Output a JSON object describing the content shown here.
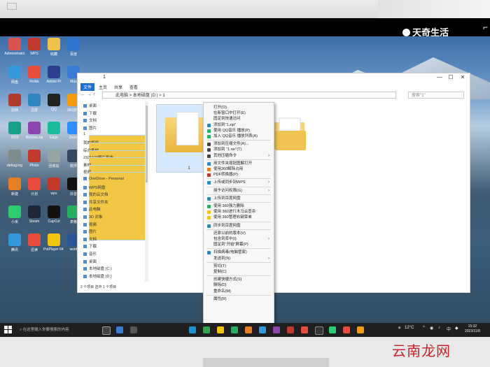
{
  "watermark": {
    "brand": "天奇生活",
    "corner_label": "云南龙网"
  },
  "desktop": {
    "icons": [
      {
        "label": "Administrator",
        "color": "#d9534f"
      },
      {
        "label": "WPS",
        "color": "#c0392b"
      },
      {
        "label": "收藏",
        "color": "#f0c14b"
      },
      {
        "label": "百度",
        "color": "#2f74d0"
      },
      {
        "label": "网盘",
        "color": "#3498db"
      },
      {
        "label": "Rollsk",
        "color": "#e74c3c"
      },
      {
        "label": "Adobe Pr",
        "color": "#2c3e8f"
      },
      {
        "label": "Max",
        "color": "#3a7bd5"
      },
      {
        "label": "剪映",
        "color": "#b03a2e"
      },
      {
        "label": "迅雷",
        "color": "#2e86c1"
      },
      {
        "label": "QQ",
        "color": "#222"
      },
      {
        "label": "360游戏",
        "color": "#f39c12"
      },
      {
        "label": "2020",
        "color": "#16a085"
      },
      {
        "label": "ReVowi.zip",
        "color": "#8e44ad"
      },
      {
        "label": "Edge",
        "color": "#1abc9c"
      },
      {
        "label": "Zoom",
        "color": "#2d8cff"
      },
      {
        "label": "debug.log",
        "color": "#7f8c8d"
      },
      {
        "label": "Photo",
        "color": "#c0392b"
      },
      {
        "label": "回收站",
        "color": "#95a5a6"
      },
      {
        "label": "软件",
        "color": "#34495e"
      },
      {
        "label": "新建",
        "color": "#e67e22"
      },
      {
        "label": "计划",
        "color": "#e74c3c"
      },
      {
        "label": "wps",
        "color": "#c0392b"
      },
      {
        "label": "抖音",
        "color": "#111"
      },
      {
        "label": "小米",
        "color": "#2ecc71"
      },
      {
        "label": "Steam",
        "color": "#1b2838"
      },
      {
        "label": "CapCut",
        "color": "#111"
      },
      {
        "label": "表格",
        "color": "#27ae60"
      },
      {
        "label": "腾讯",
        "color": "#3498db"
      },
      {
        "label": "迅读",
        "color": "#e74c3c"
      },
      {
        "label": "PotPlayer 64 bit",
        "color": "#f1c40f"
      },
      {
        "label": "word",
        "color": "#2b579a"
      }
    ]
  },
  "explorer": {
    "title": "1",
    "controls": {
      "min": "—",
      "max": "☐",
      "close": "✕"
    },
    "ribbon_tabs": [
      "文件",
      "主页",
      "共享",
      "查看"
    ],
    "address": "此电脑 > 本地磁盘 (D:) > 1",
    "search_placeholder": "搜索\"1\"",
    "nav_items": [
      {
        "label": "桌面",
        "type": "blue"
      },
      {
        "label": "下载",
        "type": "blue"
      },
      {
        "label": "文档",
        "type": "blue"
      },
      {
        "label": "图片",
        "type": "blue"
      },
      {
        "label": "1",
        "type": "folder"
      },
      {
        "label": "我的视频",
        "type": "folder"
      },
      {
        "label": "综合素材",
        "type": "folder"
      },
      {
        "label": "2321179图片和电",
        "type": "folder"
      },
      {
        "label": "素材",
        "type": "folder"
      },
      {
        "label": "视频",
        "type": "folder"
      },
      {
        "label": "OneDrive - Personal",
        "type": "blue"
      },
      {
        "label": "WPS网盘",
        "type": "blue"
      },
      {
        "label": "我的云文档",
        "type": "blue"
      },
      {
        "label": "共享文件夹",
        "type": "blue"
      },
      {
        "label": "此电脑",
        "type": "blue"
      },
      {
        "label": "3D 对象",
        "type": "blue"
      },
      {
        "label": "视频",
        "type": "blue"
      },
      {
        "label": "图片",
        "type": "blue"
      },
      {
        "label": "文档",
        "type": "blue"
      },
      {
        "label": "下载",
        "type": "blue"
      },
      {
        "label": "音乐",
        "type": "blue"
      },
      {
        "label": "桌面",
        "type": "blue"
      },
      {
        "label": "本地磁盘 (C:)",
        "type": "blue"
      },
      {
        "label": "本地磁盘 (D:)",
        "type": "blue"
      }
    ],
    "status": "2 个项目  选中 1 个项目",
    "folder_label": "1"
  },
  "context_menu": {
    "items": [
      {
        "label": "打开(O)",
        "color": "",
        "arrow": false
      },
      {
        "label": "在新窗口中打开(E)",
        "color": "",
        "arrow": false
      },
      {
        "label": "固定到快速访问",
        "color": "",
        "arrow": false
      },
      {
        "label": "添加到\"1.zip\"",
        "color": "#2e86c1",
        "arrow": false
      },
      {
        "label": "使用 QQ音乐 播放(P)",
        "color": "#27ae60",
        "arrow": false
      },
      {
        "label": "加入 QQ音乐 播放列表(A)",
        "color": "#27ae60",
        "arrow": false
      },
      {
        "sep": true
      },
      {
        "label": "添加到压缩文件(A)...",
        "color": "#444",
        "arrow": false
      },
      {
        "label": "添加到 \"1.rar\"(T)",
        "color": "#444",
        "arrow": false
      },
      {
        "label": "其他压缩命令",
        "color": "#444",
        "arrow": true
      },
      {
        "sep": true
      },
      {
        "label": "用文件夹按钮图解打开",
        "color": "#2e86c1",
        "arrow": false
      },
      {
        "label": "使用360解除占用",
        "color": "#e67e22",
        "arrow": false
      },
      {
        "label": "PDF转换器(P)",
        "color": "#c0392b",
        "arrow": false
      },
      {
        "sep": true
      },
      {
        "label": "上传或同步到WPS",
        "color": "#2e86c1",
        "arrow": true
      },
      {
        "sep": true
      },
      {
        "label": "授予访问权限(G)",
        "color": "",
        "arrow": true
      },
      {
        "sep": true
      },
      {
        "label": "上传到百度网盘",
        "color": "#2e86c1",
        "arrow": false
      },
      {
        "sep": true
      },
      {
        "label": "使用 360强力删除",
        "color": "#27ae60",
        "arrow": false
      },
      {
        "label": "使用 360进行木马云查杀",
        "color": "#f1c40f",
        "arrow": false
      },
      {
        "label": "使用 360管理右键菜单",
        "color": "#f1c40f",
        "arrow": false
      },
      {
        "sep": true
      },
      {
        "label": "同步到百度网盘",
        "color": "#2e86c1",
        "arrow": false
      },
      {
        "sep": true
      },
      {
        "label": "还原以前的版本(V)",
        "color": "",
        "arrow": false
      },
      {
        "label": "包含到库中(I)",
        "color": "",
        "arrow": true
      },
      {
        "label": "固定到\"开始\"屏幕(P)",
        "color": "",
        "arrow": false
      },
      {
        "sep": true
      },
      {
        "label": "扫描病毒(电脑管家)",
        "color": "#2e86c1",
        "arrow": false
      },
      {
        "label": "发送到(N)",
        "color": "",
        "arrow": true
      },
      {
        "sep": true
      },
      {
        "label": "剪切(T)",
        "color": "",
        "arrow": false
      },
      {
        "label": "复制(C)",
        "color": "",
        "arrow": false
      },
      {
        "sep": true
      },
      {
        "label": "创建快捷方式(S)",
        "color": "",
        "arrow": false
      },
      {
        "label": "删除(D)",
        "color": "",
        "arrow": false
      },
      {
        "label": "重命名(M)",
        "color": "",
        "arrow": false
      },
      {
        "sep": true
      },
      {
        "label": "属性(R)",
        "color": "",
        "arrow": false
      }
    ]
  },
  "taskbar": {
    "search_placeholder": "在这里输入你要搜索的内容",
    "weather": "12°C",
    "time": "15:32",
    "date": "2023/11/8"
  }
}
